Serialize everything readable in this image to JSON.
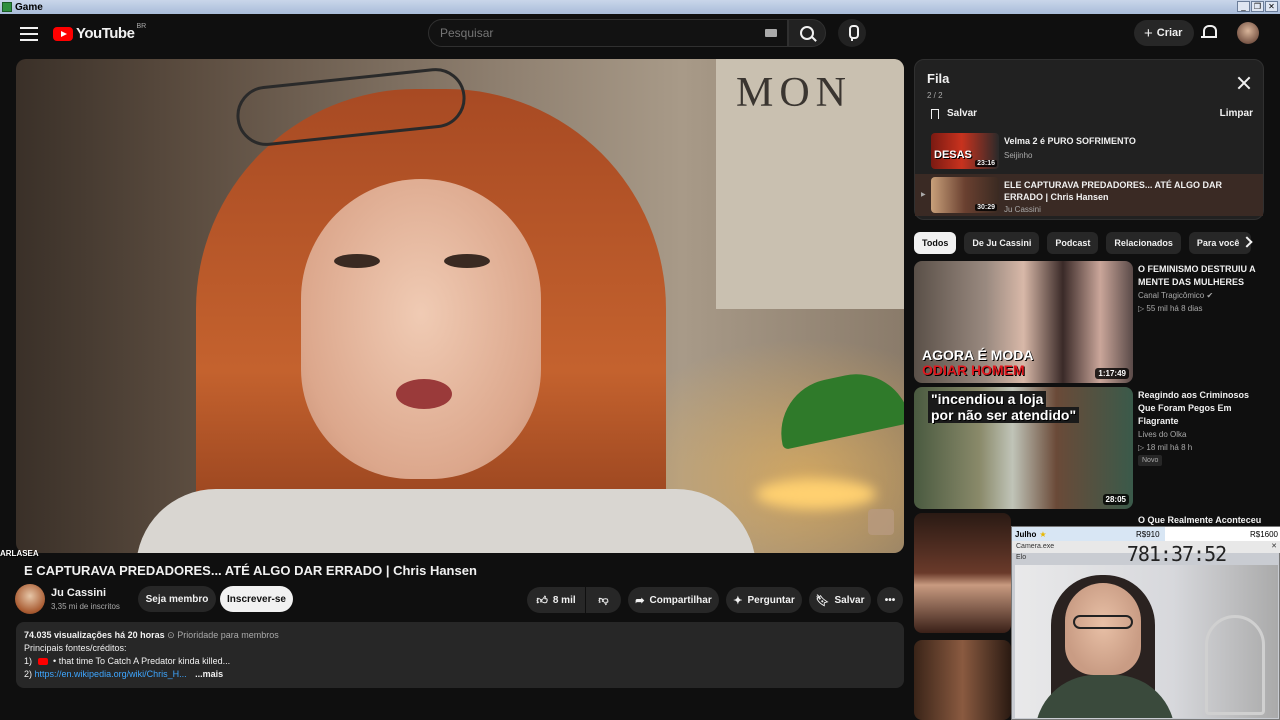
{
  "window": {
    "title": "Game"
  },
  "header": {
    "logo_text": "YouTube",
    "logo_region": "BR",
    "search_placeholder": "Pesquisar",
    "create_label": "Criar"
  },
  "video": {
    "title": "ELE CAPTURAVA PREDADORES... ATÉ ALGO DAR ERRADO | Chris Hansen",
    "title_visible": "E CAPTURAVA PREDADORES... ATÉ ALGO DAR ERRADO | Chris Hansen",
    "overlay_name": "ARLASEA",
    "wall_text": "MON"
  },
  "channel": {
    "name": "Ju Cassini",
    "subscribers": "3,35 mi de inscritos",
    "join_label": "Seja membro",
    "subscribe_label": "Inscrever-se"
  },
  "actions": {
    "likes": "8 mil",
    "share": "Compartilhar",
    "ask": "Perguntar",
    "save": "Salvar"
  },
  "description": {
    "views": "74.035 visualizações",
    "age": "há 20 horas",
    "priority": "Prioridade para membros",
    "line1": "Principais fontes/créditos:",
    "item1_num": "1)",
    "item1_text": "• that time To Catch A Predator kinda killed...",
    "item2_num": "2)",
    "item2_link": "https://en.wikipedia.org/wiki/Chris_H...",
    "more": "...mais"
  },
  "queue": {
    "title": "Fila",
    "count": "2 / 2",
    "save_label": "Salvar",
    "clear_label": "Limpar",
    "items": [
      {
        "title": "Velma 2 é PURO SOFRIMENTO",
        "channel": "Seijinho",
        "duration": "23:16",
        "thumb_text": "DESAS"
      },
      {
        "title": "ELE CAPTURAVA PREDADORES... ATÉ ALGO DAR ERRADO | Chris Hansen",
        "channel": "Ju Cassini",
        "duration": "30:29"
      }
    ]
  },
  "chips": [
    "Todos",
    "De Ju Cassini",
    "Podcast",
    "Relacionados",
    "Para você"
  ],
  "recommendations": [
    {
      "title": "O FEMINISMO DESTRUIU A MENTE DAS MULHERES",
      "channel": "Canal Tragicômico",
      "views": "55 mil",
      "age": "há 8 dias",
      "duration": "1:17:49",
      "caption1": "AGORA É MODA",
      "caption2": "ODIAR HOMEM"
    },
    {
      "title": "Reagindo aos Criminosos Que Foram Pegos Em Flagrante",
      "channel": "Lives do Olka",
      "views": "18 mil",
      "age": "há 8 h",
      "duration": "28:05",
      "badge": "Novo",
      "caption1": "\"incendiou a loja",
      "caption2": "por não ser atendido\""
    },
    {
      "title": "O Que Realmente Aconteceu"
    }
  ],
  "overlay": {
    "bar_left": "Julho",
    "bar_mid": "R$910",
    "bar_right": "R$1600",
    "progress": 0.57,
    "window_title": "Camera.exe",
    "window_sub": "Elo",
    "timer": "781:37:52"
  }
}
